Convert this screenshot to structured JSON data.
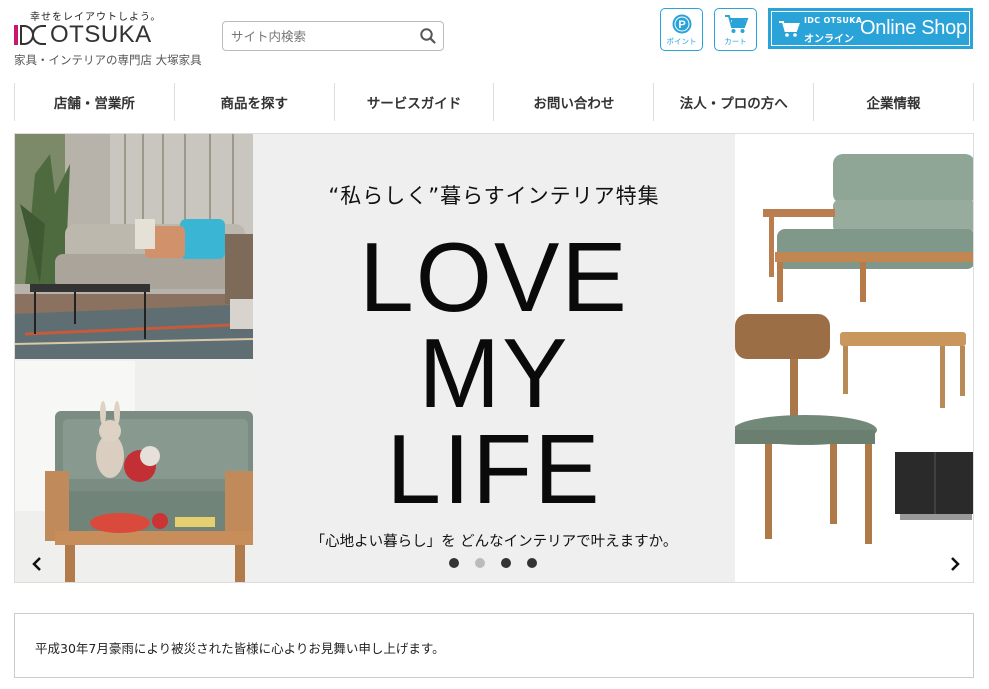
{
  "header": {
    "tagline": "幸せをレイアウトしよう。",
    "logo_text": "OTSUKA",
    "subtitle": "家具・インテリアの専門店 大塚家具",
    "search_placeholder": "サイト内検索",
    "point_label": "ポイント",
    "cart_label": "カート",
    "online": {
      "small": "IDC OTSUKA",
      "jp": "オンライン",
      "big": "Online Shop"
    }
  },
  "nav": {
    "items": [
      {
        "label": "店舗・営業所"
      },
      {
        "label": "商品を探す"
      },
      {
        "label": "サービスガイド"
      },
      {
        "label": "お問い合わせ"
      },
      {
        "label": "法人・プロの方へ"
      },
      {
        "label": "企業情報"
      }
    ]
  },
  "hero": {
    "subtitle": "“私らしく”暮らすインテリア特集",
    "line1": "LOVE",
    "line2": "MY",
    "line3": "LIFE",
    "caption": "「心地よい暮らし」を どんなインテリアで叶えますか。",
    "active_slide": 1,
    "slide_count": 4
  },
  "notice": {
    "text": "平成30年7月豪雨により被災された皆様に心よりお見舞い申し上げます。"
  },
  "colors": {
    "brand_blue": "#2aa3d9",
    "brand_magenta": "#c8176d"
  }
}
